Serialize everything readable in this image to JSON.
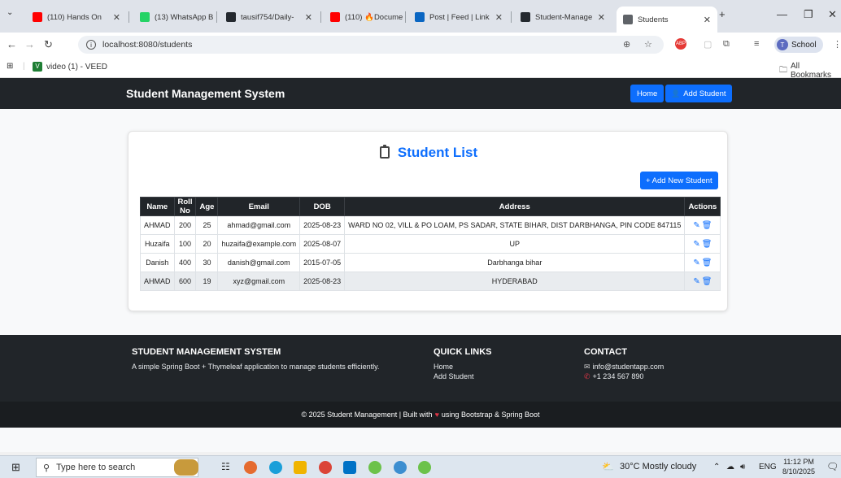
{
  "browser": {
    "tabs": [
      {
        "title": "(110) Hands On",
        "favicon": "youtube-icon",
        "color": "#ff0000"
      },
      {
        "title": "(13) WhatsApp B",
        "favicon": "whatsapp-icon",
        "color": "#25d366"
      },
      {
        "title": "tausif754/Daily-",
        "favicon": "github-icon",
        "color": "#24292f"
      },
      {
        "title": "(110) 🔥Docume",
        "favicon": "youtube-icon",
        "color": "#ff0000"
      },
      {
        "title": "Post | Feed | Link",
        "favicon": "linkedin-icon",
        "color": "#0a66c2"
      },
      {
        "title": "Student-Manage",
        "favicon": "github-icon",
        "color": "#24292f"
      },
      {
        "title": "Students",
        "favicon": "globe-icon",
        "color": "#5f6368",
        "active": true
      }
    ],
    "url": "localhost:8080/students",
    "profile_label": "School",
    "profile_initial": "T",
    "bookmark": "video (1) - VEED",
    "all_bookmarks": "All Bookmarks"
  },
  "nav": {
    "brand": "Student Management System",
    "home": "Home",
    "add_student": "Add Student"
  },
  "list": {
    "title": "Student List",
    "add_new": "+ Add New Student",
    "columns": [
      "Name",
      "Roll No",
      "Age",
      "Email",
      "DOB",
      "Address",
      "Actions"
    ],
    "rows": [
      {
        "name": "AHMAD",
        "roll": "200",
        "age": "25",
        "email": "ahmad@gmail.com",
        "dob": "2025-08-23",
        "address": "WARD NO 02, VILL & PO LOAM, PS SADAR, STATE BIHAR, DIST DARBHANGA, PIN CODE 847115"
      },
      {
        "name": "Huzaifa",
        "roll": "100",
        "age": "20",
        "email": "huzaifa@example.com",
        "dob": "2025-08-07",
        "address": "UP"
      },
      {
        "name": "Danish",
        "roll": "400",
        "age": "30",
        "email": "danish@gmail.com",
        "dob": "2015-07-05",
        "address": "Darbhanga bihar"
      },
      {
        "name": "AHMAD",
        "roll": "600",
        "age": "19",
        "email": "xyz@gmail.com",
        "dob": "2025-08-23",
        "address": "HYDERABAD"
      }
    ]
  },
  "footer": {
    "about_title": "STUDENT MANAGEMENT SYSTEM",
    "about_text": "A simple Spring Boot + Thymeleaf application to manage students efficiently.",
    "links_title": "QUICK LINKS",
    "link_home": "Home",
    "link_add": "Add Student",
    "contact_title": "CONTACT",
    "email": "info@studentapp.com",
    "phone": "+1 234 567 890",
    "copyright_pre": "© 2025 Student Management | Built with",
    "copyright_post": "using Bootstrap & Spring Boot"
  },
  "taskbar": {
    "search_placeholder": "Type here to search",
    "weather": "30°C  Mostly cloudy",
    "lang": "ENG",
    "time": "11:12 PM",
    "date": "8/10/2025"
  },
  "colors": {
    "primary": "#0d6efd",
    "dark": "#212529"
  }
}
